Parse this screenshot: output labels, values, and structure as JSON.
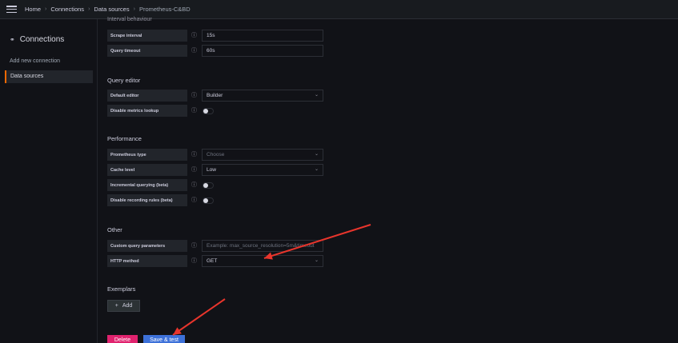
{
  "breadcrumb": {
    "items": [
      "Home",
      "Connections",
      "Data sources"
    ],
    "current": "Prometheus-C&BD",
    "separator": "›"
  },
  "sidebar": {
    "title": "Connections",
    "add_link": "Add new connection",
    "active_item": "Data sources"
  },
  "interval_section": {
    "title": "Interval behaviour",
    "rows": [
      {
        "label": "Scrape interval",
        "value": "15s"
      },
      {
        "label": "Query timeout",
        "value": "60s"
      }
    ]
  },
  "query_editor": {
    "title": "Query editor",
    "default_editor_label": "Default editor",
    "default_editor_value": "Builder",
    "disable_lookup_label": "Disable metrics lookup"
  },
  "performance": {
    "title": "Performance",
    "prom_type_label": "Prometheus type",
    "prom_type_placeholder": "Choose",
    "cache_label": "Cache level",
    "cache_value": "Low",
    "incremental_label": "Incremental querying (beta)",
    "recording_label": "Disable recording rules (beta)"
  },
  "other": {
    "title": "Other",
    "custom_params_label": "Custom query parameters",
    "custom_params_placeholder": "Example: max_source_resolution=5m&timeout",
    "http_method_label": "HTTP method",
    "http_method_value": "GET"
  },
  "exemplars": {
    "title": "Exemplars",
    "add_label": "Add"
  },
  "actions": {
    "delete_label": "Delete",
    "save_label": "Save & test"
  },
  "colors": {
    "annotation_arrow": "#e8352c",
    "save_button": "#3d71d9",
    "delete_button": "#e0226e",
    "active_accent": "#f46800"
  }
}
